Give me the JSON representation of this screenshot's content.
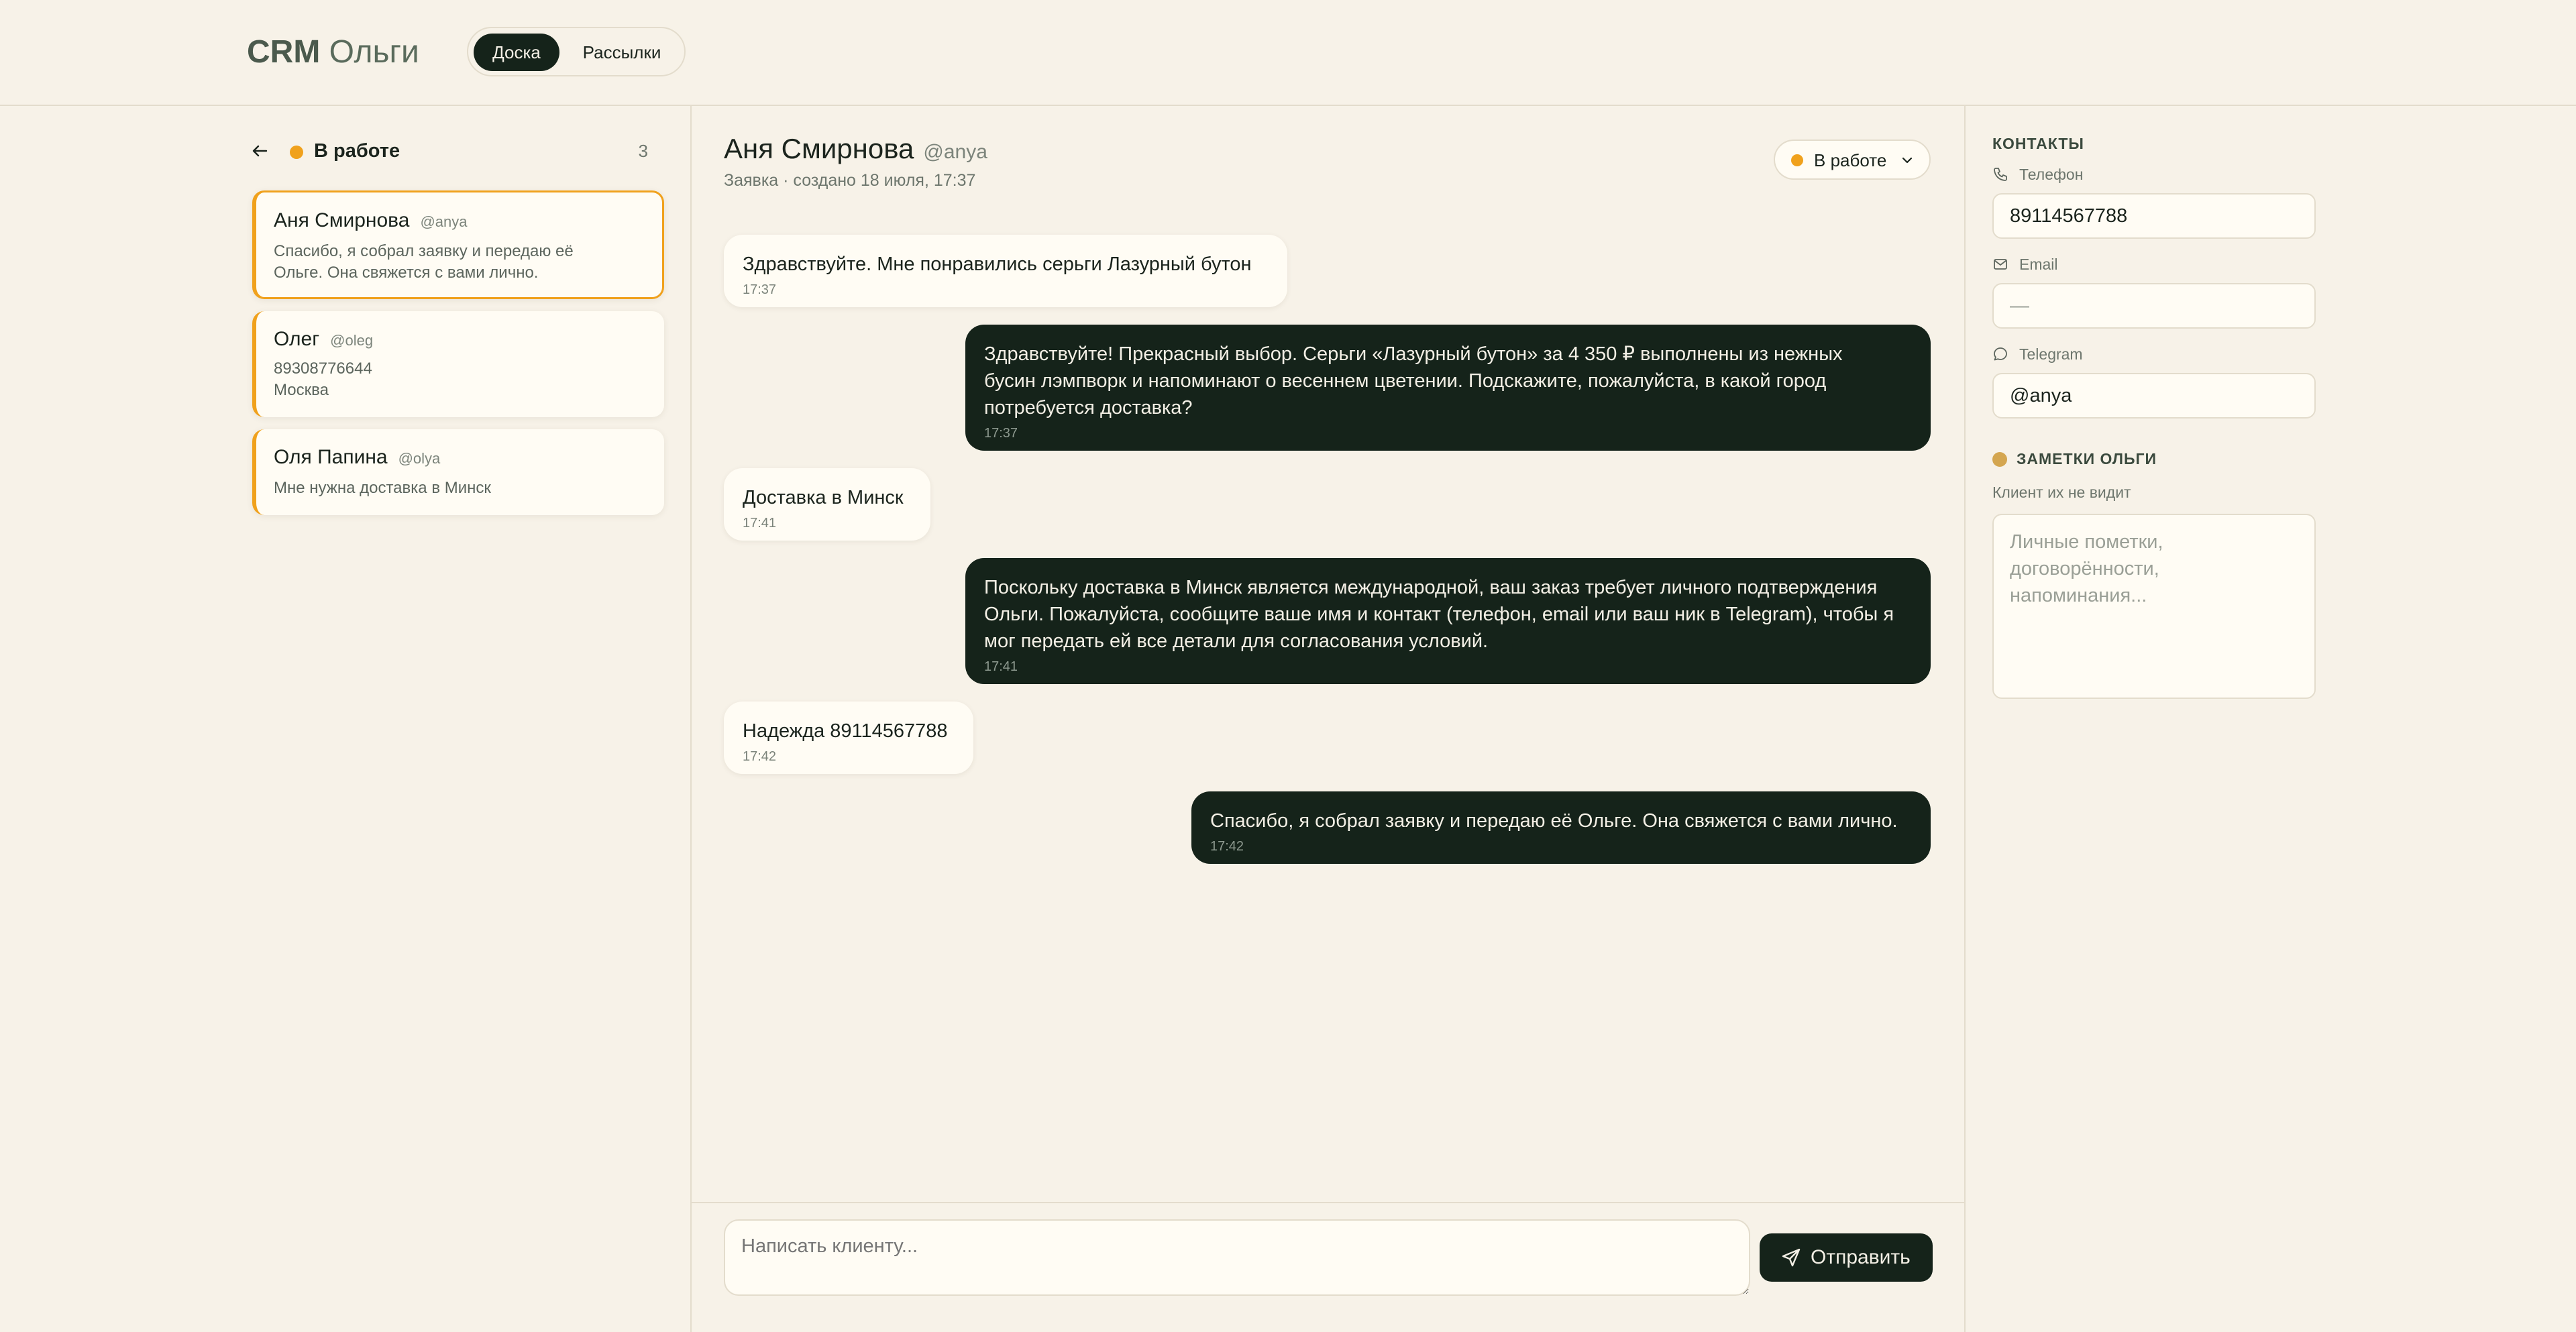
{
  "header": {
    "brand_bold": "CRM",
    "brand_rest": "Ольги",
    "tabs": [
      {
        "label": "Доска",
        "active": true
      },
      {
        "label": "Рассылки",
        "active": false
      }
    ]
  },
  "board": {
    "column_title": "В работе",
    "count": "3",
    "status_color": "#f0a11c",
    "cards": [
      {
        "name": "Аня Смирнова",
        "handle": "@anya",
        "lines": [
          "Спасибо, я собрал заявку и передаю её",
          "Ольге. Она свяжется с вами лично."
        ],
        "selected": true
      },
      {
        "name": "Олег",
        "handle": "@oleg",
        "lines": [
          "89308776644",
          "Москва"
        ],
        "selected": false
      },
      {
        "name": "Оля Папина",
        "handle": "@olya",
        "lines": [
          "Мне нужна доставка в Минск"
        ],
        "selected": false
      }
    ]
  },
  "chat": {
    "name": "Аня Смирнова",
    "handle": "@anya",
    "subtitle": "Заявка · создано 18 июля, 17:37",
    "status": "В работе",
    "messages": [
      {
        "dir": "in",
        "lines": [
          "Здравствуйте. Мне понравились серьги Лазурный бутон"
        ],
        "time": "17:37"
      },
      {
        "dir": "out",
        "lines": [
          "Здравствуйте! Прекрасный выбор. Серьги «Лазурный бутон» за 4 350 ₽ выполнены из нежных",
          "бусин лэмпворк и напоминают о весеннем цветении. Подскажите, пожалуйста, в какой город",
          "потребуется доставка?"
        ],
        "time": "17:37"
      },
      {
        "dir": "in",
        "lines": [
          "Доставка в Минск"
        ],
        "time": "17:41"
      },
      {
        "dir": "out",
        "lines": [
          "Поскольку доставка в Минск является международной, ваш заказ требует личного подтверждения",
          "Ольги. Пожалуйста, сообщите ваше имя и контакт (телефон, email или ваш ник в Telegram), чтобы я",
          "мог передать ей все детали для согласования условий."
        ],
        "time": "17:41"
      },
      {
        "dir": "in",
        "lines": [
          "Надежда 89114567788"
        ],
        "time": "17:42"
      },
      {
        "dir": "out",
        "lines": [
          "Спасибо, я собрал заявку и передаю её Ольге. Она свяжется с вами лично."
        ],
        "time": "17:42"
      }
    ],
    "composer_placeholder": "Написать клиенту...",
    "send_label": "Отправить"
  },
  "contacts": {
    "title": "КОНТАКТЫ",
    "phone_label": "Телефон",
    "phone_value": "89114567788",
    "email_label": "Email",
    "email_value": "—",
    "telegram_label": "Telegram",
    "telegram_value": "@anya",
    "notes_title": "ЗАМЕТКИ ОЛЬГИ",
    "notes_hint": "Клиент их не видит",
    "notes_placeholder": "Личные пометки, договорённости, напоминания..."
  }
}
